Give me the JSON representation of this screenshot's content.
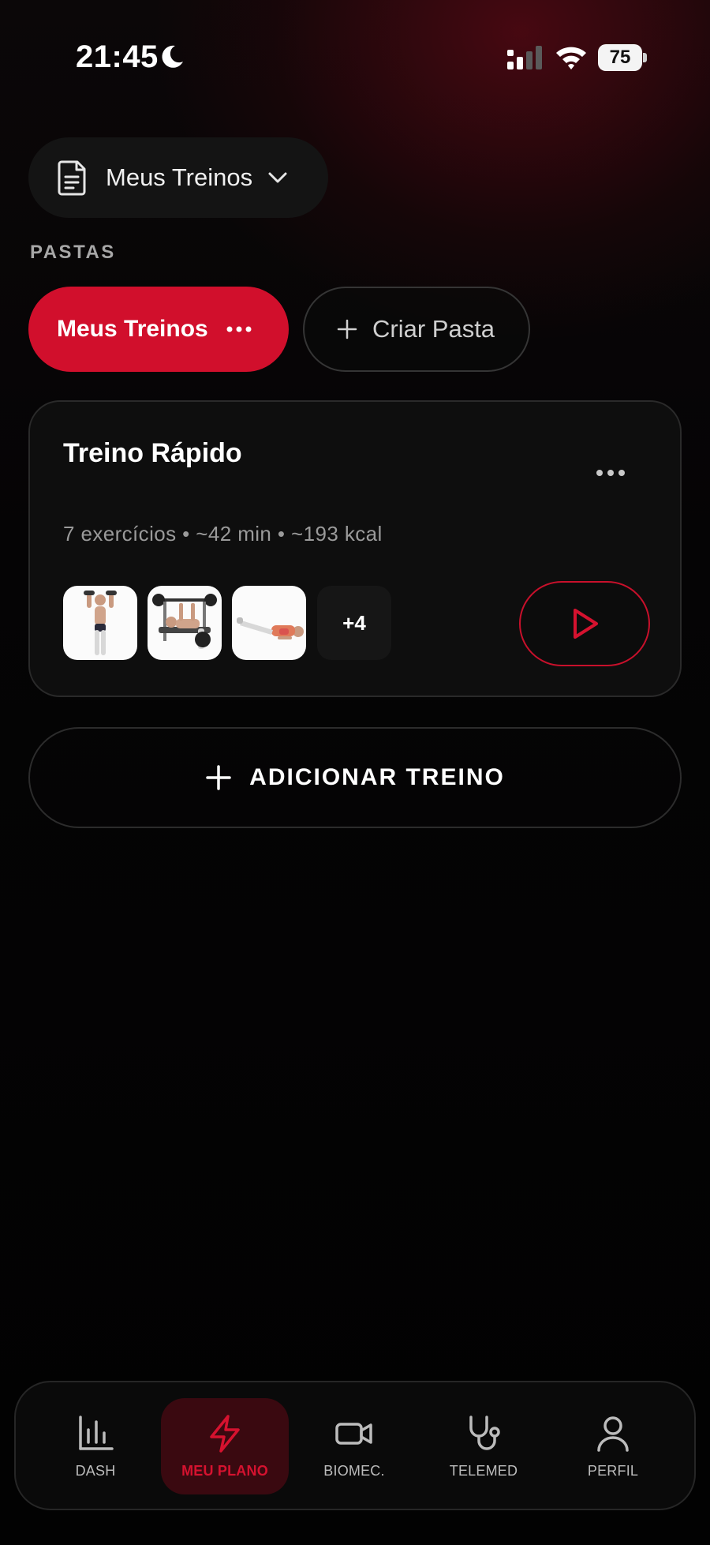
{
  "status_bar": {
    "time": "21:45",
    "battery": "75"
  },
  "selector": {
    "label": "Meus Treinos"
  },
  "folders": {
    "section_label": "PASTAS",
    "active_label": "Meus Treinos",
    "create_label": "Criar Pasta"
  },
  "workout": {
    "title": "Treino Rápido",
    "meta": "7 exercícios • ~42 min • ~193 kcal",
    "more_count": "+4"
  },
  "add_button": {
    "label": "ADICIONAR TREINO"
  },
  "nav": {
    "items": [
      {
        "label": "DASH",
        "icon": "bar-chart-icon"
      },
      {
        "label": "MEU PLANO",
        "icon": "lightning-icon"
      },
      {
        "label": "BIOMEC.",
        "icon": "video-camera-icon"
      },
      {
        "label": "TELEMED",
        "icon": "stethoscope-icon"
      },
      {
        "label": "PERFIL",
        "icon": "user-icon"
      }
    ],
    "active_index": 1
  },
  "colors": {
    "accent": "#d10f2c",
    "background": "#030303",
    "card": "#0e0e0e",
    "nav_active_bg": "#3a0910"
  }
}
